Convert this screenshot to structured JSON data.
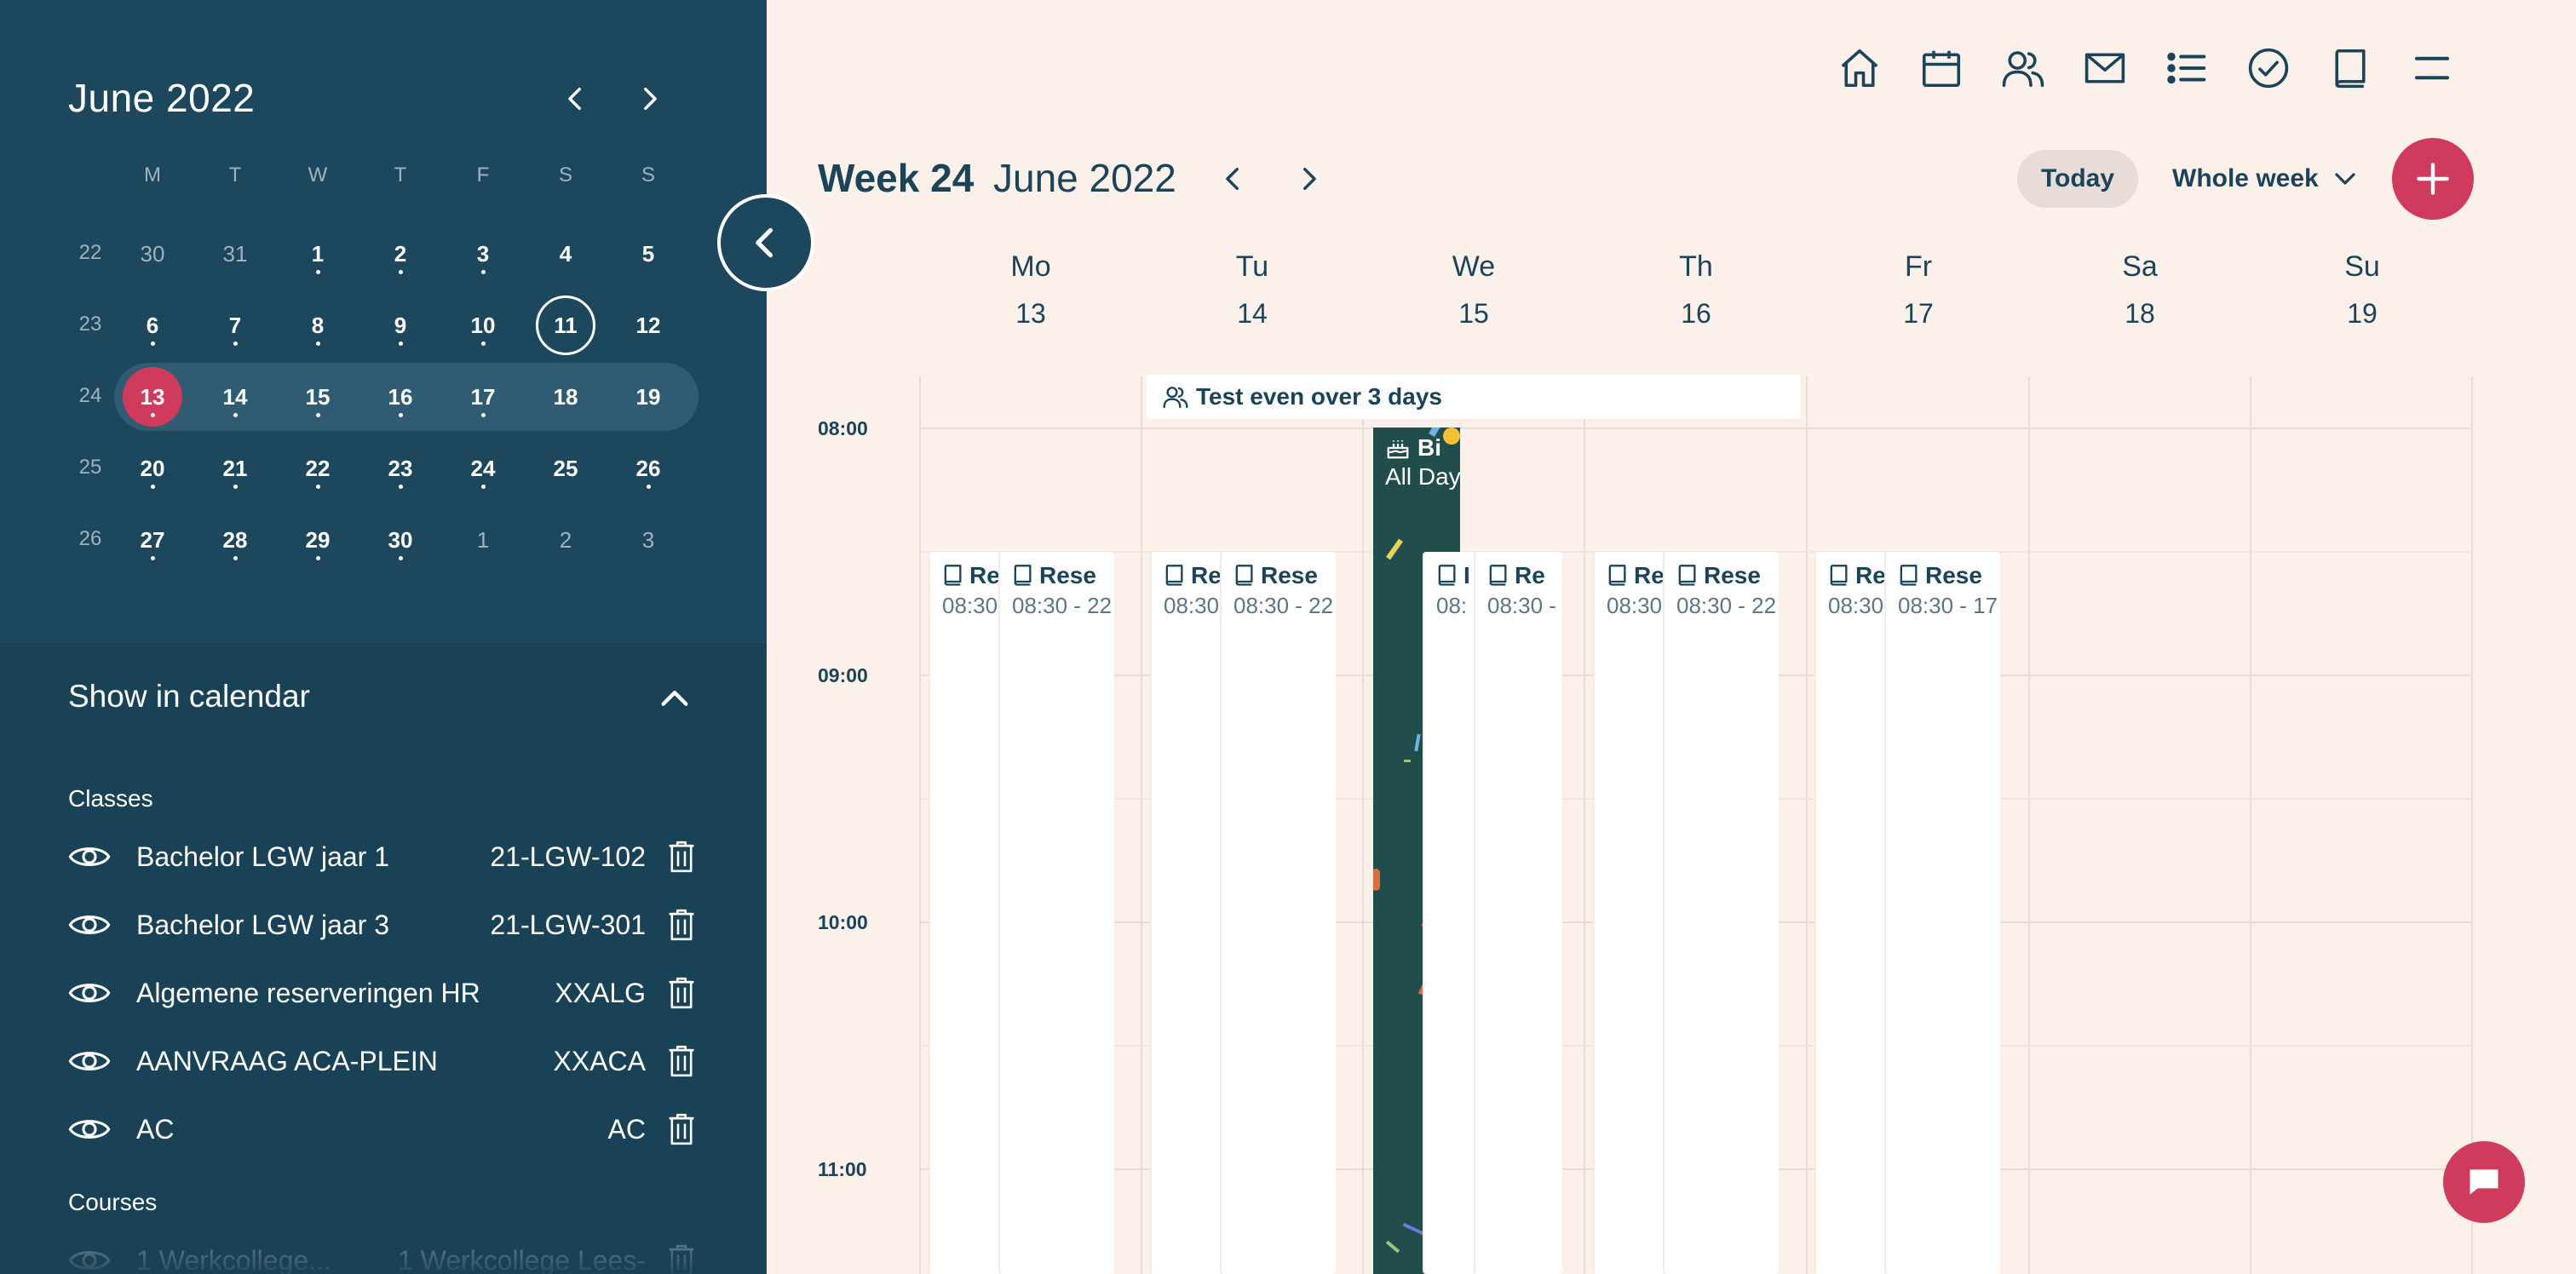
{
  "sidebar": {
    "mini_calendar": {
      "title": "June 2022",
      "weekdays": [
        "M",
        "T",
        "W",
        "T",
        "F",
        "S",
        "S"
      ],
      "weeks": [
        {
          "week": "22",
          "days": [
            "30",
            "31",
            "1",
            "2",
            "3",
            "4",
            "5"
          ]
        },
        {
          "week": "23",
          "days": [
            "6",
            "7",
            "8",
            "9",
            "10",
            "11",
            "12"
          ]
        },
        {
          "week": "24",
          "days": [
            "13",
            "14",
            "15",
            "16",
            "17",
            "18",
            "19"
          ]
        },
        {
          "week": "25",
          "days": [
            "20",
            "21",
            "22",
            "23",
            "24",
            "25",
            "26"
          ]
        },
        {
          "week": "26",
          "days": [
            "27",
            "28",
            "29",
            "30",
            "1",
            "2",
            "3"
          ]
        }
      ],
      "today": "11",
      "selected": "13"
    },
    "show_in_calendar": {
      "title": "Show in calendar",
      "classes_label": "Classes",
      "classes": [
        {
          "name": "Bachelor LGW jaar 1",
          "code": "21-LGW-102"
        },
        {
          "name": "Bachelor LGW jaar 3",
          "code": "21-LGW-301"
        },
        {
          "name": "Algemene reserveringen HR",
          "code": "XXALG"
        },
        {
          "name": "AANVRAAG ACA-PLEIN",
          "code": "XXACA"
        },
        {
          "name": "AC",
          "code": "AC"
        }
      ],
      "courses_label": "Courses",
      "courses": [
        {
          "name": "1 Werkcollege...",
          "code": "1 Werkcollege Lees-"
        }
      ]
    }
  },
  "topnav": {
    "icons": [
      "home-icon",
      "calendar-icon",
      "people-icon",
      "mail-icon",
      "list-icon",
      "check-circle-icon",
      "book-icon",
      "menu-icon"
    ]
  },
  "header": {
    "week": "Week 24",
    "month": "June 2022",
    "today": "Today",
    "view": "Whole week"
  },
  "days": [
    {
      "name": "Mo",
      "date": "13"
    },
    {
      "name": "Tu",
      "date": "14"
    },
    {
      "name": "We",
      "date": "15"
    },
    {
      "name": "Th",
      "date": "16"
    },
    {
      "name": "Fr",
      "date": "17"
    },
    {
      "name": "Sa",
      "date": "18"
    },
    {
      "name": "Su",
      "date": "19"
    }
  ],
  "times": [
    "08:00",
    "09:00",
    "10:00",
    "11:00"
  ],
  "multi_day_event": {
    "title": "Test even over 3 days"
  },
  "birthday_event": {
    "title": "Bi",
    "subtitle": "All Day"
  },
  "events": [
    {
      "day": 0,
      "title": "Re",
      "time": "08:30"
    },
    {
      "day": 0,
      "title": "Rese",
      "time": "08:30 - 22"
    },
    {
      "day": 1,
      "title": "Re",
      "time": "08:30"
    },
    {
      "day": 1,
      "title": "Rese",
      "time": "08:30 - 22"
    },
    {
      "day": 2,
      "title": "I",
      "time": "08:"
    },
    {
      "day": 2,
      "title": "Re",
      "time": "08:30 -"
    },
    {
      "day": 3,
      "title": "Re",
      "time": "08:30"
    },
    {
      "day": 3,
      "title": "Rese",
      "time": "08:30 - 22"
    },
    {
      "day": 4,
      "title": "Re",
      "time": "08:30"
    },
    {
      "day": 4,
      "title": "Rese",
      "time": "08:30 - 17"
    }
  ],
  "colors": {
    "sidebar": "#1d475d",
    "background": "#fcf0eb",
    "accent": "#cf3b5d",
    "text": "#1b4459",
    "birthday": "#214d4d"
  }
}
